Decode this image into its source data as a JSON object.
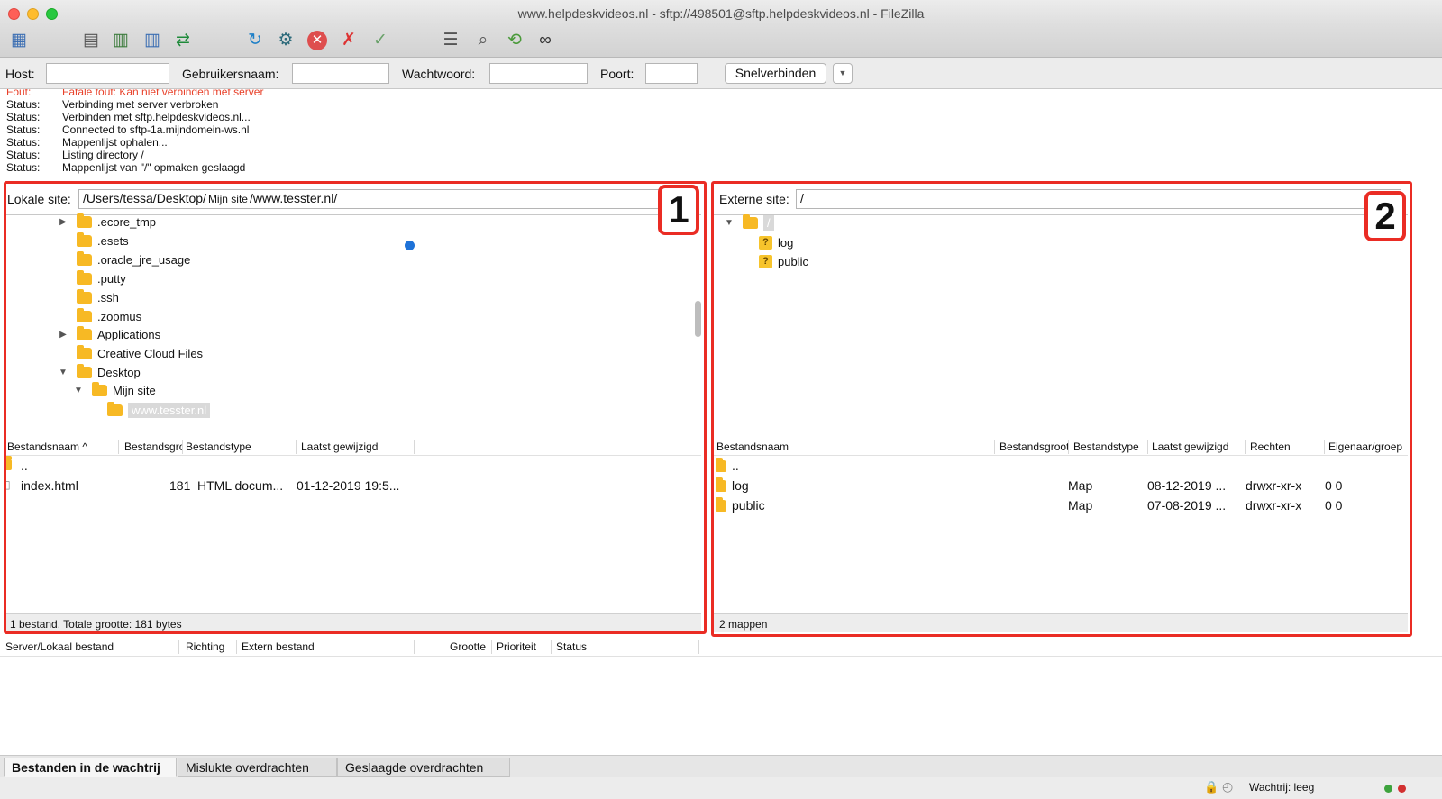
{
  "window": {
    "title": "www.helpdeskvideos.nl - sftp://498501@sftp.helpdeskvideos.nl - FileZilla"
  },
  "toolbar": {
    "icons": [
      "site-manager-icon",
      "toggle-log-icon",
      "toggle-local-tree-icon",
      "toggle-remote-tree-icon",
      "toggle-queue-icon",
      "refresh-icon",
      "process-queue-icon",
      "cancel-icon",
      "disconnect-icon",
      "reconnect-icon",
      "filter-icon",
      "compare-icon",
      "sync-browse-icon",
      "search-icon"
    ]
  },
  "quickconnect": {
    "host_label": "Host:",
    "host_value": "",
    "user_label": "Gebruikersnaam:",
    "user_value": "",
    "pass_label": "Wachtwoord:",
    "pass_value": "",
    "port_label": "Poort:",
    "port_value": "",
    "button_label": "Snelverbinden"
  },
  "log": {
    "lines": [
      {
        "kind": "Fout:",
        "text": "Fatale fout: Kan niet verbinden met server",
        "error": true
      },
      {
        "kind": "Status:",
        "text": "Verbinding met server verbroken"
      },
      {
        "kind": "Status:",
        "text": "Verbinden met sftp.helpdeskvideos.nl..."
      },
      {
        "kind": "Status:",
        "text": "Connected to sftp-1a.mijndomein-ws.nl"
      },
      {
        "kind": "Status:",
        "text": "Mappenlijst ophalen..."
      },
      {
        "kind": "Status:",
        "text": "Listing directory /"
      },
      {
        "kind": "Status:",
        "text": "Mappenlijst van \"/\" opmaken geslaagd"
      }
    ]
  },
  "local": {
    "label": "Lokale site:",
    "path_a": "/Users/tessa/Desktop/",
    "path_b": "Mijn site",
    "path_c": "/www.tesster.nl/",
    "tree": [
      {
        "name": ".ecore_tmp",
        "arrow": "▶"
      },
      {
        "name": ".esets",
        "arrow": ""
      },
      {
        "name": ".oracle_jre_usage",
        "arrow": ""
      },
      {
        "name": ".putty",
        "arrow": ""
      },
      {
        "name": ".ssh",
        "arrow": ""
      },
      {
        "name": ".zoomus",
        "arrow": ""
      },
      {
        "name": "Applications",
        "arrow": "▶"
      },
      {
        "name": "Creative Cloud Files",
        "arrow": ""
      },
      {
        "name": "Desktop",
        "arrow": "▼"
      },
      {
        "name": "Mijn site",
        "arrow": "▼"
      },
      {
        "name": "www.tesster.nl",
        "arrow": ""
      }
    ],
    "columns": [
      "Bestandsnaam",
      "Bestandsgroot",
      "Bestandstype",
      "Laatst gewijzigd"
    ],
    "files": [
      {
        "name": "..",
        "size": "",
        "type": "",
        "modified": ""
      },
      {
        "name": "index.html",
        "size": "181",
        "type": "HTML docum...",
        "modified": "01-12-2019 19:5..."
      }
    ],
    "status": "1 bestand. Totale grootte: 181 bytes",
    "badge": "1"
  },
  "remote": {
    "label": "Externe site:",
    "path": "/",
    "tree": [
      {
        "name": "/",
        "arrow": "▼"
      },
      {
        "name": "log",
        "arrow": ""
      },
      {
        "name": "public",
        "arrow": ""
      }
    ],
    "columns": [
      "Bestandsnaam",
      "Bestandsgrootte",
      "Bestandstype",
      "Laatst gewijzigd",
      "Rechten",
      "Eigenaar/groep"
    ],
    "files": [
      {
        "name": "..",
        "size": "",
        "type": "",
        "modified": "",
        "perms": "",
        "owner": ""
      },
      {
        "name": "log",
        "size": "",
        "type": "Map",
        "modified": "08-12-2019 ...",
        "perms": "drwxr-xr-x",
        "owner": "0 0"
      },
      {
        "name": "public",
        "size": "",
        "type": "Map",
        "modified": "07-08-2019 ...",
        "perms": "drwxr-xr-x",
        "owner": "0 0"
      }
    ],
    "status": "2 mappen",
    "badge": "2"
  },
  "queue": {
    "columns": [
      "Server/Lokaal bestand",
      "Richting",
      "Extern bestand",
      "Grootte",
      "Prioriteit",
      "Status"
    ],
    "tabs": [
      "Bestanden in de wachtrij",
      "Mislukte overdrachten",
      "Geslaagde overdrachten"
    ],
    "status": "Wachtrij: leeg"
  },
  "colors": {
    "annotation": "#ea2c24",
    "folder": "#f7b924",
    "error_text": "#e8412a"
  }
}
